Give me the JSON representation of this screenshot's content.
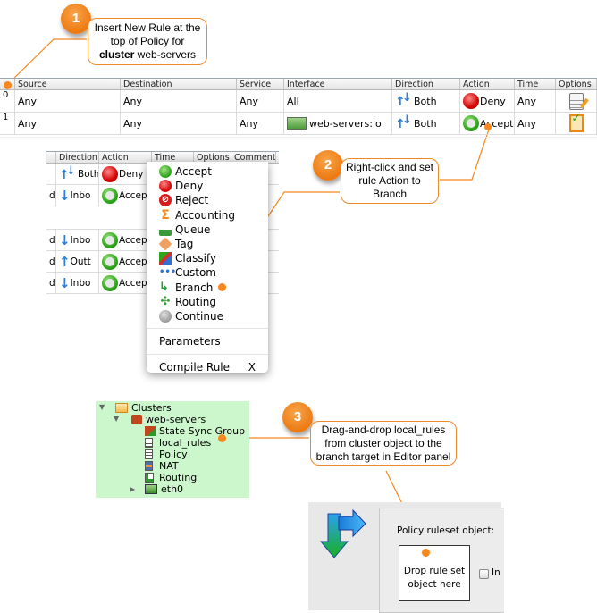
{
  "steps": [
    {
      "number": "1",
      "text_parts": [
        "Insert New Rule at the top of Policy for ",
        "cluster",
        " web-servers"
      ]
    },
    {
      "number": "2",
      "text": "Right-click and set rule Action to Branch"
    },
    {
      "number": "3",
      "text": "Drag-and-drop local_rules from cluster object to the branch target in Editor panel"
    }
  ],
  "policy_table": {
    "columns": [
      "",
      "Source",
      "Destination",
      "Service",
      "Interface",
      "Direction",
      "Action",
      "Time",
      "Options"
    ],
    "rows": [
      {
        "num": "0",
        "source": "Any",
        "destination": "Any",
        "service": "Any",
        "interface": "All",
        "interface_icon": "",
        "direction": "Both",
        "action": "Deny",
        "time": "Any",
        "options_icon": "note-icon"
      },
      {
        "num": "1",
        "source": "Any",
        "destination": "Any",
        "service": "Any",
        "interface": "web-servers:lo",
        "interface_icon": "interface-icon",
        "direction": "Both",
        "action": "Accept",
        "time": "Any",
        "options_icon": "options-icon"
      }
    ]
  },
  "context_table": {
    "columns": [
      "",
      "Direction",
      "Action",
      "Time",
      "Options",
      "Comment"
    ],
    "rows": [
      {
        "prefix": "",
        "direction": "Both",
        "dir_icon": "both",
        "action": "Deny"
      },
      {
        "prefix": "de",
        "direction": "Inbo",
        "dir_icon": "in",
        "action": "Accep"
      },
      {
        "prefix": "de",
        "direction": "Inbo",
        "dir_icon": "in",
        "action": "Accep"
      },
      {
        "prefix": "de",
        "direction": "Outt",
        "dir_icon": "out",
        "action": "Accep"
      },
      {
        "prefix": "de",
        "direction": "Inbo",
        "dir_icon": "in",
        "action": "Accep"
      }
    ]
  },
  "context_menu": {
    "actions": [
      {
        "label": "Accept",
        "icon": "accept-icon",
        "color": "#2fa51c"
      },
      {
        "label": "Deny",
        "icon": "deny-icon",
        "color": "#d30000"
      },
      {
        "label": "Reject",
        "icon": "reject-icon",
        "color": "#d81c1c"
      },
      {
        "label": "Accounting",
        "icon": "accounting-icon",
        "color": "#f08a1c"
      },
      {
        "label": "Queue",
        "icon": "queue-icon",
        "color": "#3a9a3a"
      },
      {
        "label": "Tag",
        "icon": "tag-icon",
        "color": "#f0a060"
      },
      {
        "label": "Classify",
        "icon": "classify-icon",
        "color": "#d03030"
      },
      {
        "label": "Custom",
        "icon": "custom-icon",
        "color": "#3070d0"
      },
      {
        "label": "Branch",
        "icon": "branch-icon",
        "color": "#20a030"
      },
      {
        "label": "Routing",
        "icon": "routing-icon",
        "color": "#30a030"
      },
      {
        "label": "Continue",
        "icon": "continue-icon",
        "color": "#a0a0a0"
      }
    ],
    "parameters": "Parameters",
    "compile": "Compile Rule",
    "compile_shortcut": "X"
  },
  "tree": {
    "root": "Clusters",
    "cluster": "web-servers",
    "children": [
      "State Sync Group",
      "local_rules",
      "Policy",
      "NAT",
      "Routing"
    ],
    "interface": "eth0"
  },
  "editor": {
    "label": "Policy ruleset object:",
    "drop_text": "Drop rule set object here",
    "checkbox_label": "In"
  },
  "colors": {
    "accent_orange": "#f7881f",
    "tree_bg": "#ccf7cc"
  }
}
